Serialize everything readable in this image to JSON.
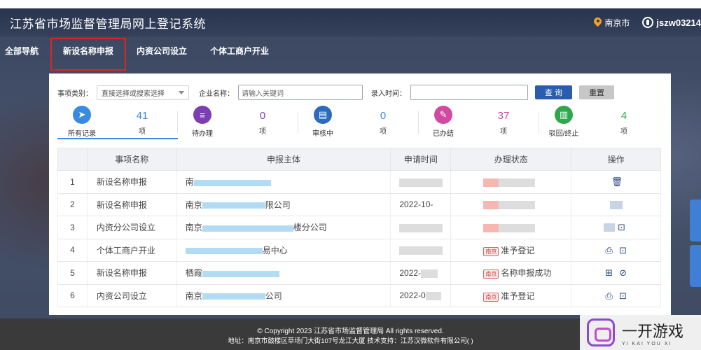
{
  "header": {
    "title": "江苏省市场监督管理局网上登记系统",
    "location": "南京市",
    "username": "jszw03214"
  },
  "nav": {
    "items": [
      "全部导航",
      "新设名称申报",
      "内资公司设立",
      "个体工商户开业"
    ],
    "active": "新设名称申报"
  },
  "filters": {
    "category_label": "事项类别：",
    "category_value": "直接选择或搜索选择",
    "company_label": "企业名称：",
    "company_placeholder": "请输入关键词",
    "time_label": "录入时间：",
    "time_value": "",
    "query_button": "查 询",
    "reset_button": "重置"
  },
  "stats": [
    {
      "name": "所有记录",
      "count": "41",
      "unit": "项",
      "icon": "send-icon",
      "color": "#3a8be0",
      "num_color": "#3a8be0"
    },
    {
      "name": "待办理",
      "count": "0",
      "unit": "项",
      "icon": "document-icon",
      "color": "#7b3fb3",
      "num_color": "#7b3fb3"
    },
    {
      "name": "审核中",
      "count": "0",
      "unit": "项",
      "icon": "review-icon",
      "color": "#2c6ac0",
      "num_color": "#3a8be0"
    },
    {
      "name": "已办结",
      "count": "37",
      "unit": "项",
      "icon": "pen-icon",
      "color": "#d04aa0",
      "num_color": "#c04a9c"
    },
    {
      "name": "驳回/终止",
      "count": "4",
      "unit": "项",
      "icon": "reject-icon",
      "color": "#2ea84a",
      "num_color": "#2ea84a"
    }
  ],
  "table": {
    "headers": [
      "",
      "事项名称",
      "申报主体",
      "申请时间",
      "办理状态",
      "操作"
    ],
    "rows": [
      {
        "index": "1",
        "type": "新设名称申报",
        "subject_visible": "南",
        "subject_suffix": "",
        "time": "",
        "tag": "",
        "status": "",
        "ops": [
          "trash-icon"
        ]
      },
      {
        "index": "2",
        "type": "新设名称申报",
        "subject_visible": "南京",
        "subject_suffix": "限公司",
        "time": "2022-10-",
        "tag": "",
        "status": "",
        "ops": []
      },
      {
        "index": "3",
        "type": "内资分公司设立",
        "subject_visible": "南京",
        "subject_suffix": "楼分公司",
        "time": "",
        "tag": "",
        "status": "",
        "ops": [
          "scan-icon"
        ]
      },
      {
        "index": "4",
        "type": "个体工商户开业",
        "subject_visible": "",
        "subject_suffix": "易中心",
        "time": "",
        "tag": "南京",
        "status": "准予登记",
        "ops": [
          "print-icon",
          "scan-icon"
        ]
      },
      {
        "index": "5",
        "type": "新设名称申报",
        "subject_visible": "栖霞",
        "subject_suffix": "",
        "time": "2022-",
        "tag": "南京",
        "status": "名称申报成功",
        "ops": [
          "grid-icon",
          "ban-icon"
        ]
      },
      {
        "index": "6",
        "type": "内资公司设立",
        "subject_visible": "南京",
        "subject_suffix": "公司",
        "time": "2022-0",
        "tag": "南京",
        "status": "准予登记",
        "ops": [
          "print-icon",
          "scan-icon"
        ]
      }
    ]
  },
  "footer": {
    "copyright": "© Copyright 2023 江苏省市场监督管理局 All rights reserved.",
    "address": "地址：南京市鼓楼区草场门大街107号龙江大厦    技术支持：江苏汉微软件有限公司( )"
  },
  "watermark": {
    "title": "一开游戏",
    "subtitle": "YI KAI YOU XI"
  }
}
